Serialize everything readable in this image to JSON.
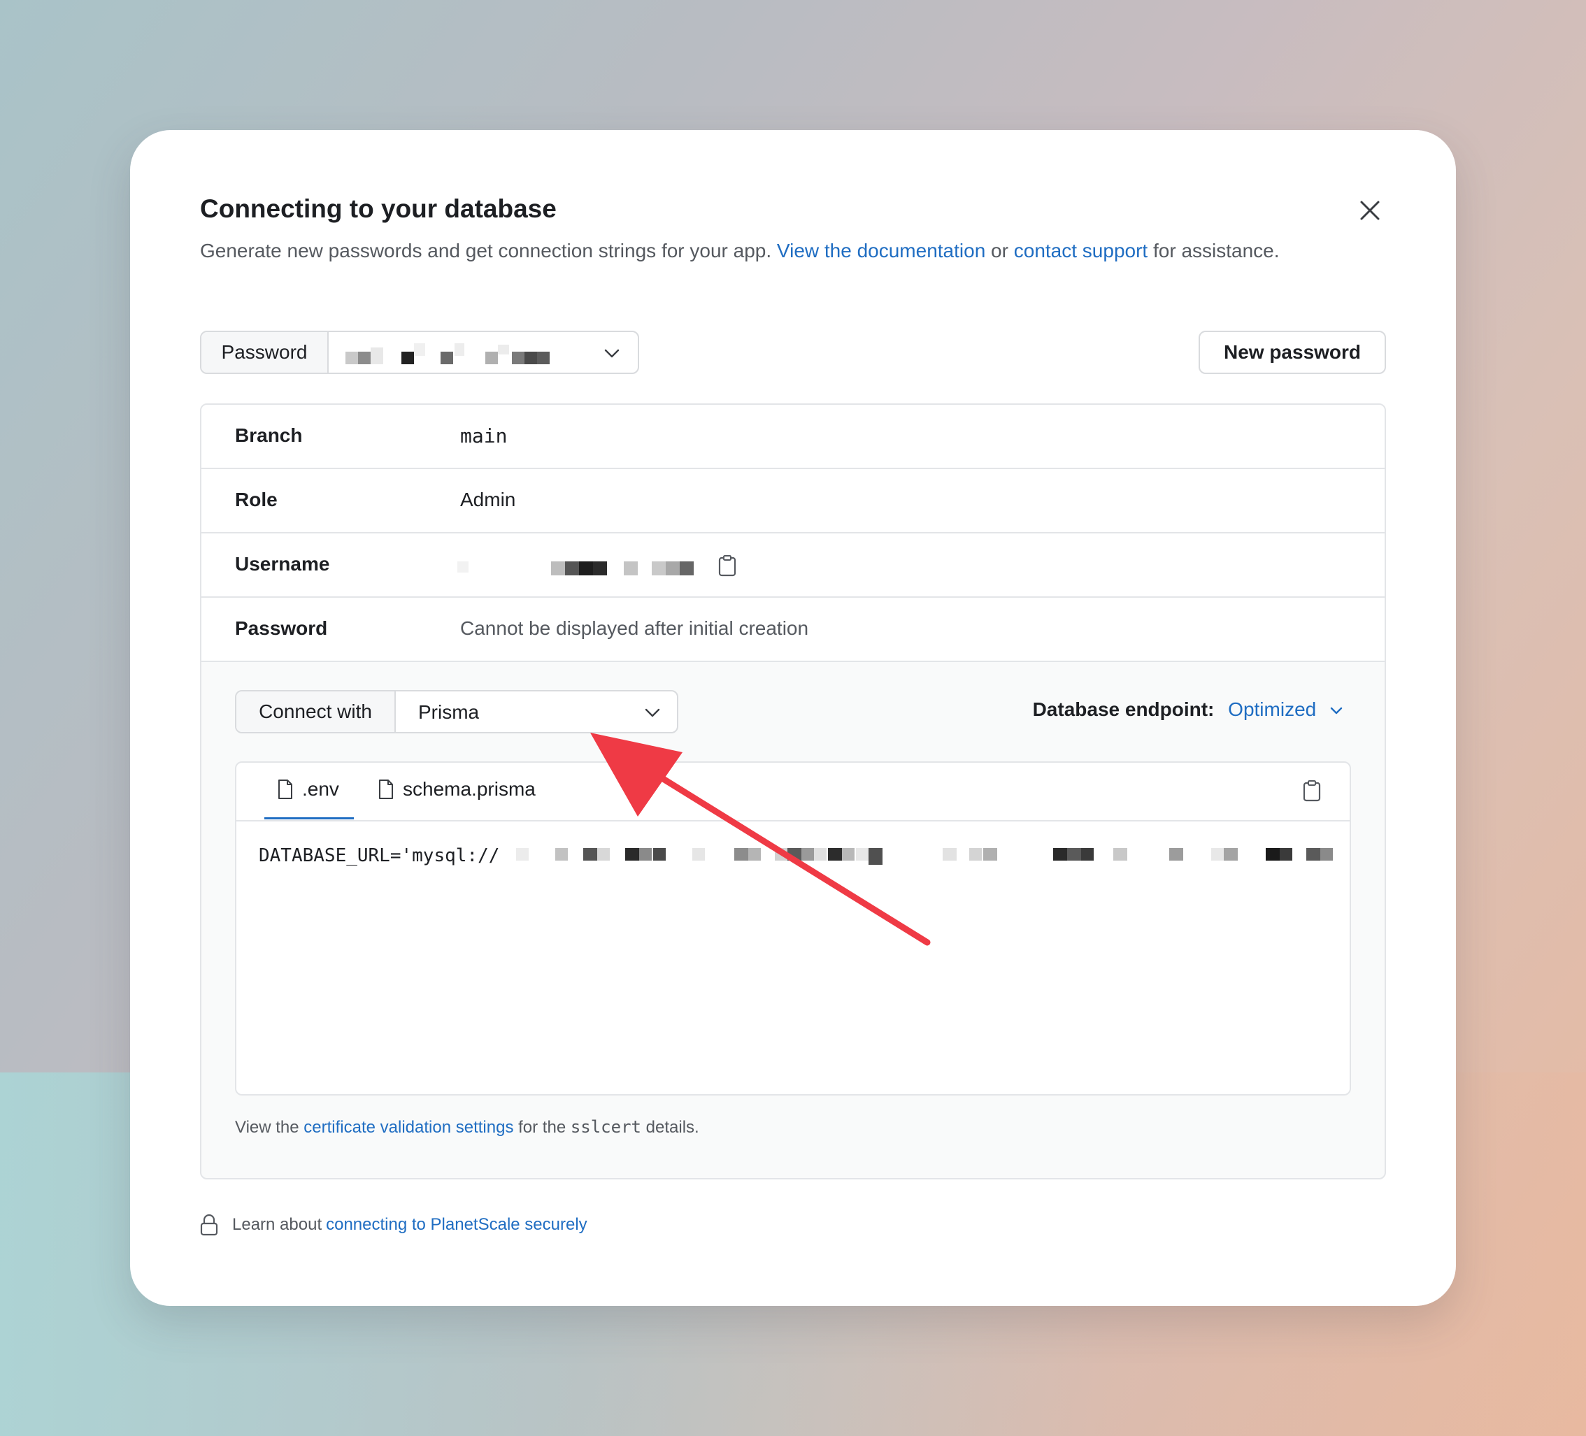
{
  "modal": {
    "title": "Connecting to your database",
    "description_prefix": "Generate new passwords and get connection strings for your app. ",
    "doc_link": "View the documentation",
    "desc_or": " or ",
    "support_link": "contact support",
    "desc_suffix": " for assistance."
  },
  "password_select": {
    "label": "Password",
    "value_icon": "chevron-down-icon"
  },
  "new_password_button": "New password",
  "details": [
    {
      "label": "Branch",
      "value": "main"
    },
    {
      "label": "Role",
      "value": "Admin"
    },
    {
      "label": "Username",
      "value": ""
    },
    {
      "label": "Password",
      "value": "Cannot be displayed after initial creation"
    }
  ],
  "connect": {
    "label": "Connect with",
    "value": "Prisma"
  },
  "endpoint": {
    "label": "Database endpoint:",
    "value": "Optimized"
  },
  "tabs": [
    {
      "label": ".env",
      "active": true
    },
    {
      "label": "schema.prisma",
      "active": false
    }
  ],
  "code": {
    "prefix": "DATABASE_URL='mysql://"
  },
  "footnote": {
    "prefix": "View the ",
    "link": "certificate validation settings",
    "middle": " for the ",
    "code": "sslcert",
    "suffix": " details."
  },
  "security": {
    "prefix": "Learn about ",
    "link": "connecting to PlanetScale securely"
  },
  "colors": {
    "accent": "#1f6dc2",
    "arrow": "#ef3a45",
    "border": "#e3e5e8",
    "text": "#1d1f23",
    "muted": "#55595f"
  }
}
